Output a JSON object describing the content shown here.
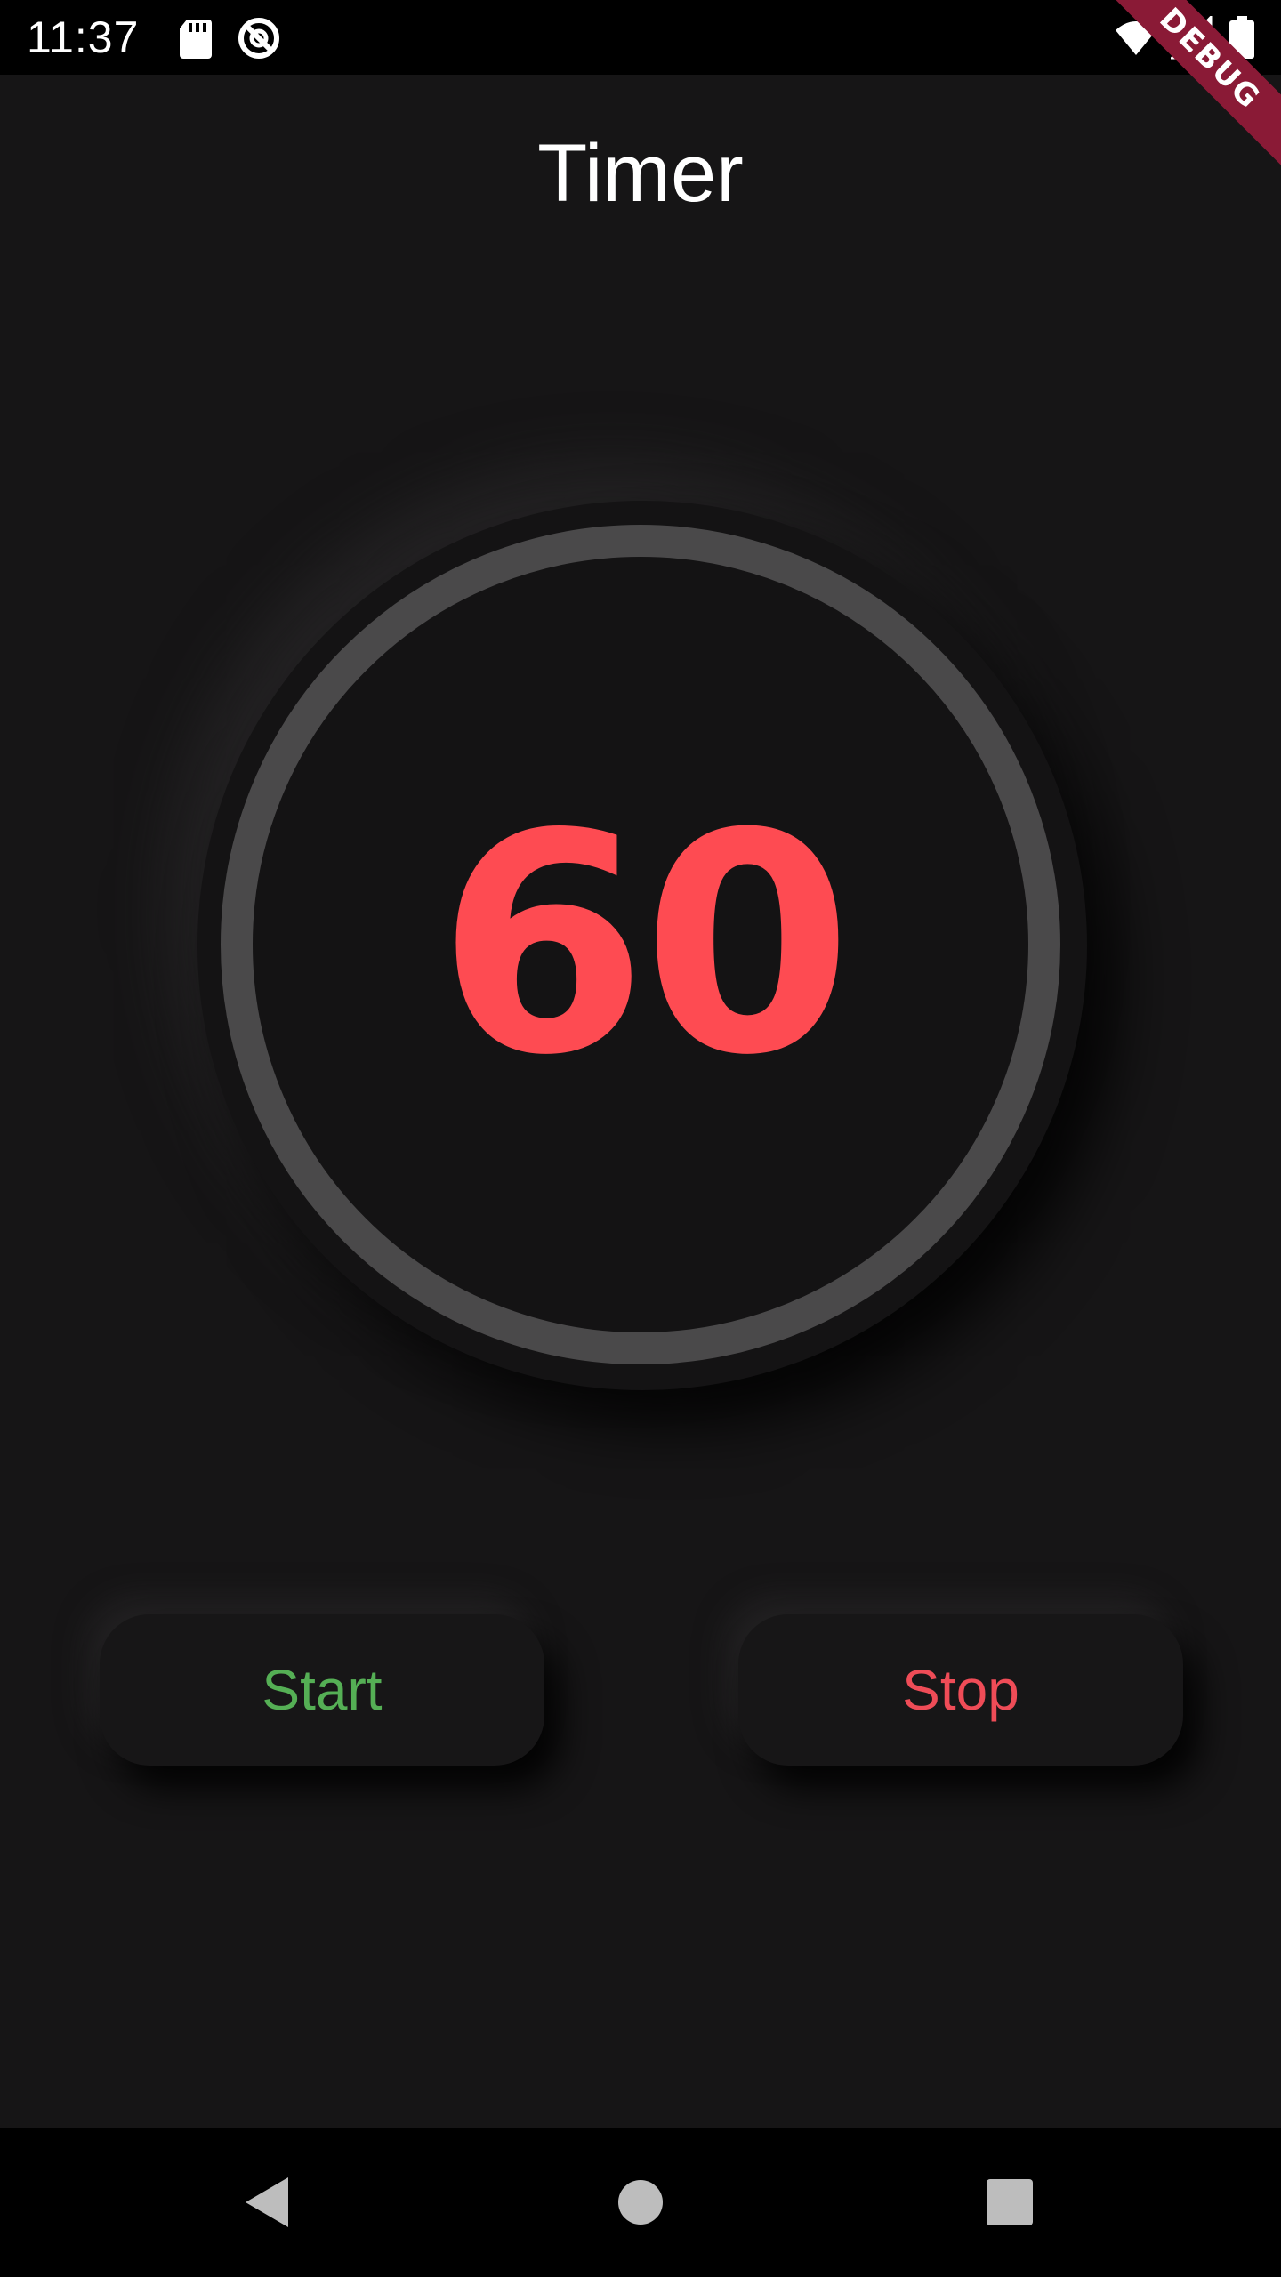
{
  "status_bar": {
    "time": "11:37",
    "icons": [
      "sd-card-icon",
      "do-not-disturb-icon",
      "wifi-icon",
      "signal-icon",
      "battery-icon"
    ]
  },
  "debug_banner": {
    "label": "DEBUG"
  },
  "app_bar": {
    "title": "Timer"
  },
  "timer": {
    "value": "60"
  },
  "buttons": {
    "start_label": "Start",
    "stop_label": "Stop"
  },
  "nav_bar": {
    "icons": [
      "back-icon",
      "home-icon",
      "recents-icon"
    ]
  },
  "colors": {
    "background": "#161516",
    "timer_text": "#fe4b52",
    "ring": "#4a494a",
    "start": "#55af55",
    "stop": "#ef4c57",
    "debug_banner": "#8a1a36"
  }
}
